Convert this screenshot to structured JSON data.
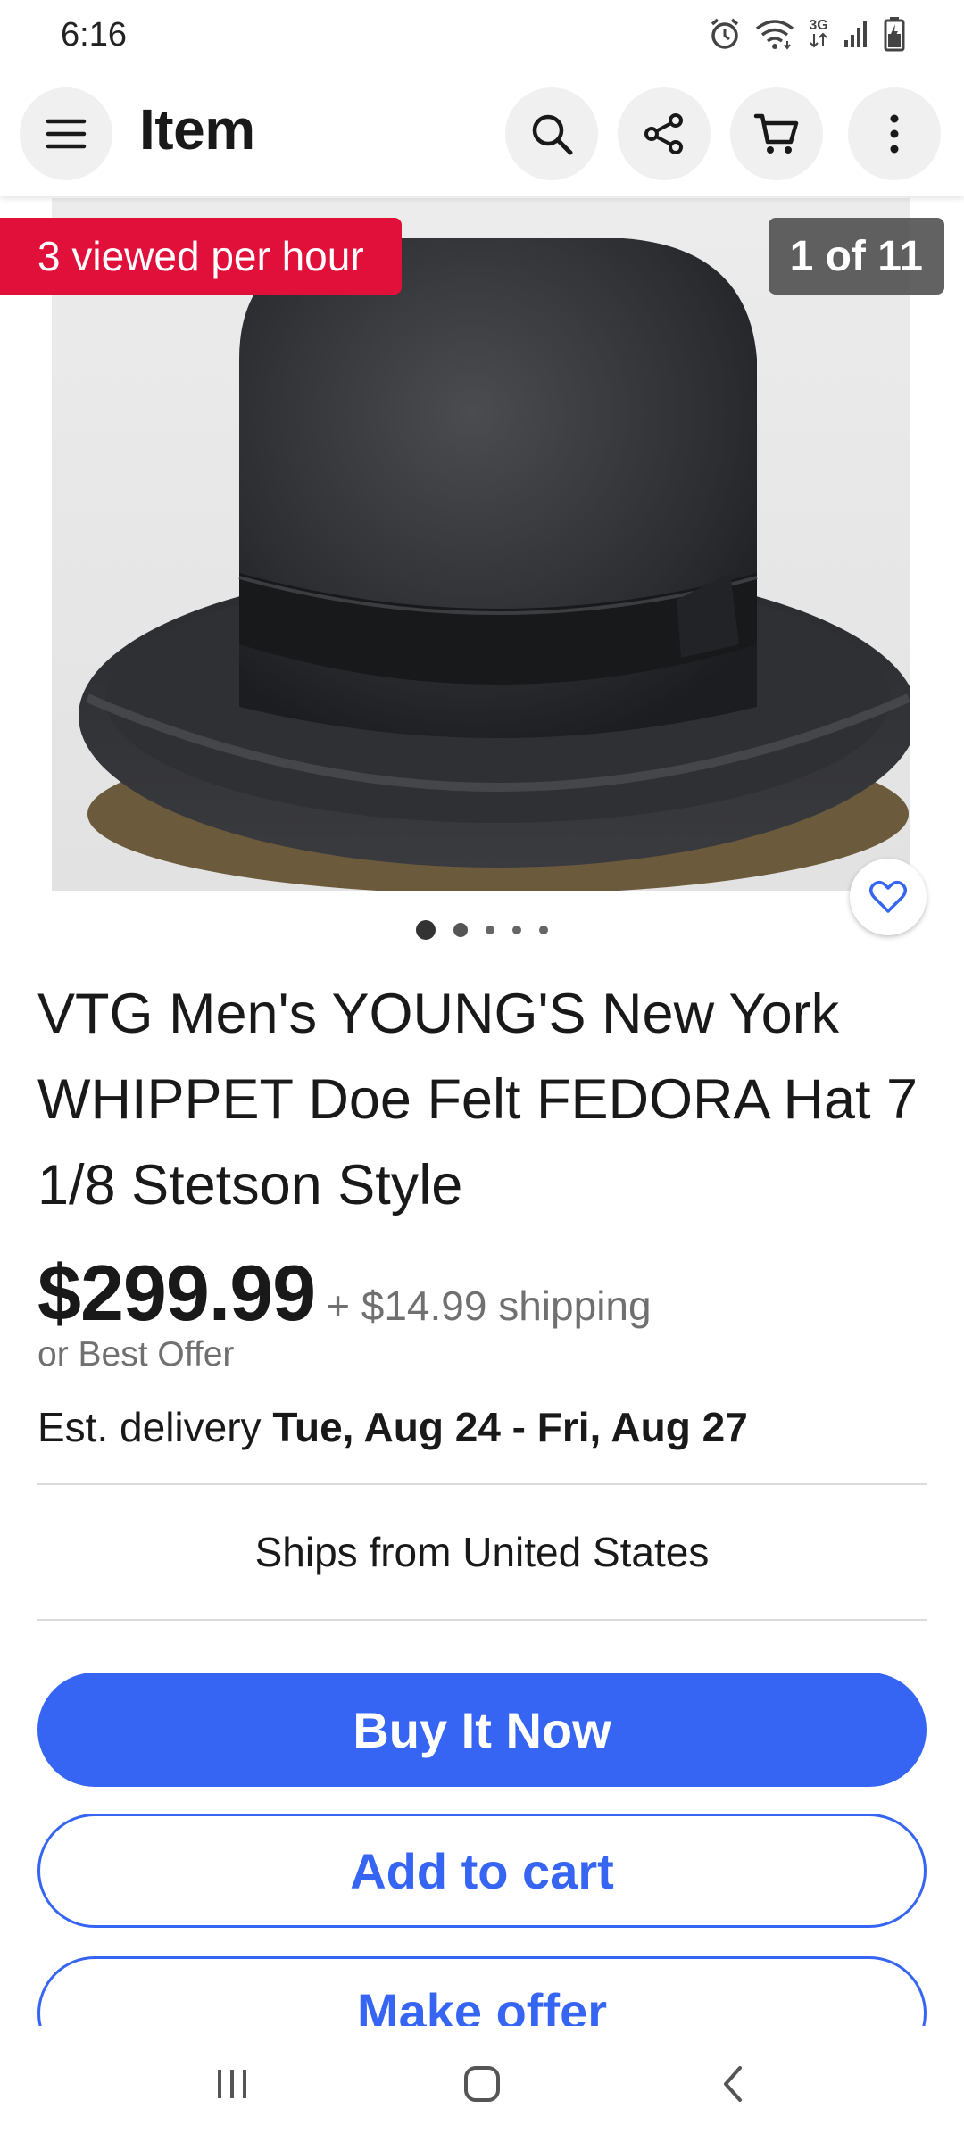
{
  "status_bar": {
    "time": "6:16",
    "network_label": "3G",
    "icons": [
      "alarm-icon",
      "wifi-icon",
      "network-3g-icon",
      "signal-icon",
      "battery-icon"
    ]
  },
  "app_bar": {
    "title": "Item",
    "icons": [
      "menu-icon",
      "search-icon",
      "share-icon",
      "cart-icon",
      "more-vert-icon"
    ]
  },
  "gallery": {
    "viewed_badge": "3 viewed per hour",
    "counter": "1 of 11",
    "dots": 5,
    "active_dot": 0
  },
  "listing": {
    "title": "VTG Men's YOUNG'S New York WHIPPET Doe Felt FEDORA Hat 7 1/8 Stetson Style",
    "price": "$299.99",
    "shipping": "+ $14.99 shipping",
    "best_offer": "or Best Offer",
    "delivery_prefix": "Est. delivery ",
    "delivery_dates": "Tue, Aug 24 - Fri, Aug 27",
    "ships_from": "Ships from United States"
  },
  "actions": {
    "buy_now": "Buy It Now",
    "add_to_cart": "Add to cart",
    "make_offer": "Make offer"
  },
  "nav_bar": {
    "icons": [
      "recents-icon",
      "home-icon",
      "back-icon"
    ]
  },
  "colors": {
    "accent": "#3665f3",
    "badge_red": "#e0103a",
    "text": "#191919",
    "muted": "#707070"
  }
}
